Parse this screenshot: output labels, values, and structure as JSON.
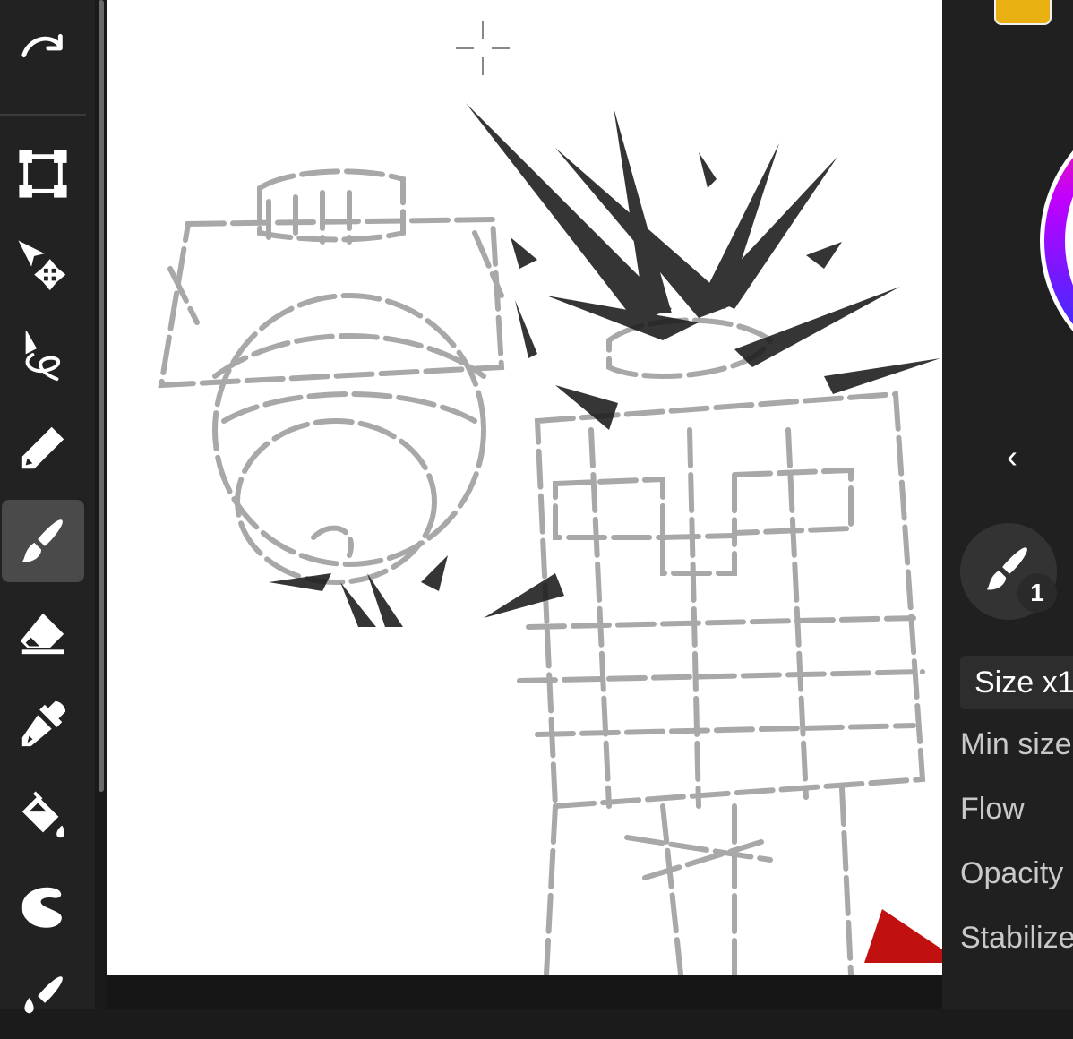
{
  "toolbar": {
    "tools": [
      {
        "name": "redo",
        "icon": "redo-icon"
      },
      {
        "name": "transform",
        "icon": "transform-icon"
      },
      {
        "name": "move",
        "icon": "move-icon"
      },
      {
        "name": "lasso",
        "icon": "lasso-icon"
      },
      {
        "name": "pencil",
        "icon": "pencil-icon"
      },
      {
        "name": "brush",
        "icon": "brush-icon",
        "active": true
      },
      {
        "name": "eraser",
        "icon": "eraser-icon"
      },
      {
        "name": "eyedropper",
        "icon": "eyedropper-icon"
      },
      {
        "name": "fill",
        "icon": "fill-bucket-icon"
      },
      {
        "name": "smudge",
        "icon": "smudge-icon"
      },
      {
        "name": "blur",
        "icon": "blur-brush-icon"
      }
    ]
  },
  "right_panel": {
    "color": "#e8b010",
    "collapse_icon": "chevron-left-icon",
    "brush_number": "1",
    "size_label": "Size x1",
    "properties": {
      "min_size": "Min size",
      "flow": "Flow",
      "opacity": "Opacity",
      "stabilizer": "Stabilize"
    }
  },
  "theme": {
    "toolbar_bg": "#222222",
    "active_tool_bg": "#4a4a4a",
    "canvas_bg": "#ffffff",
    "accent_red": "#c01010"
  }
}
